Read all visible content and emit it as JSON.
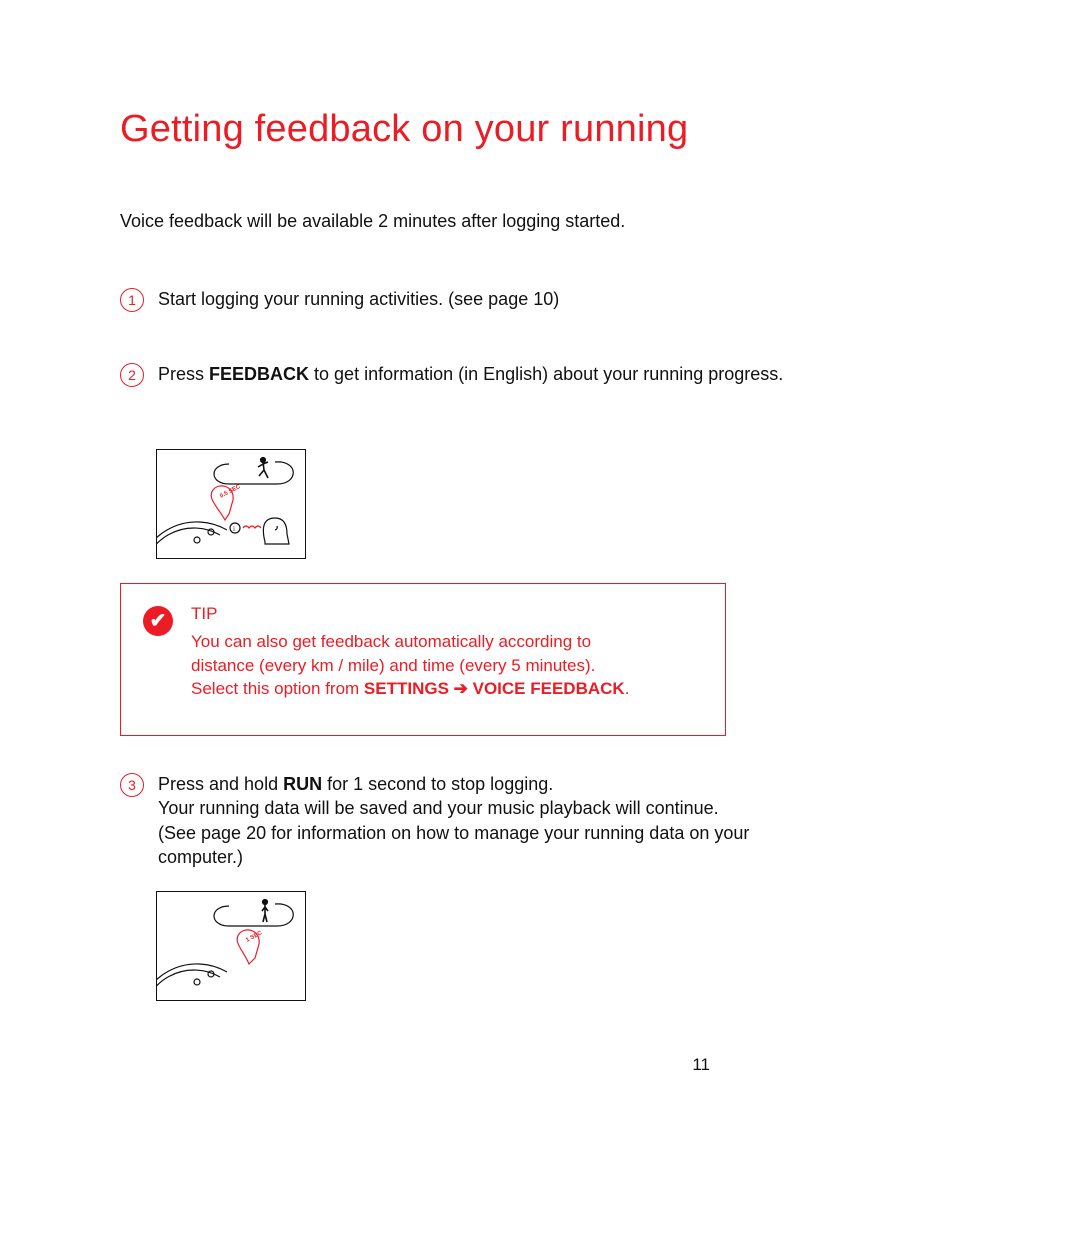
{
  "title": "Getting feedback on your running",
  "intro": "Voice feedback will be available 2 minutes after logging started.",
  "steps": {
    "s1": {
      "num": "1",
      "text": "Start logging your running activities.  (see page 10)"
    },
    "s2": {
      "num": "2",
      "pre": "Press ",
      "bold": "FEEDBACK",
      "post": " to get information (in English) about your running progress."
    },
    "s3": {
      "num": "3",
      "pre": "Press and hold ",
      "bold": "RUN",
      "post": " for 1 second to stop logging.",
      "line2": "Your running data will be saved and your music playback will continue.",
      "line3": "(See page 20 for information on how  to manage your running data on your computer.)"
    }
  },
  "tip": {
    "label": "TIP",
    "line1": "You can also get feedback automatically according to distance (every km / mile) and time (every 5 minutes).",
    "line2_pre": "Select this option from ",
    "line2_bold": "SETTINGS ➔ VOICE FEEDBACK",
    "line2_post": "."
  },
  "illus": {
    "i1_label": "0.5 SEC",
    "i2_label": "1 SEC"
  },
  "page_number": "11"
}
